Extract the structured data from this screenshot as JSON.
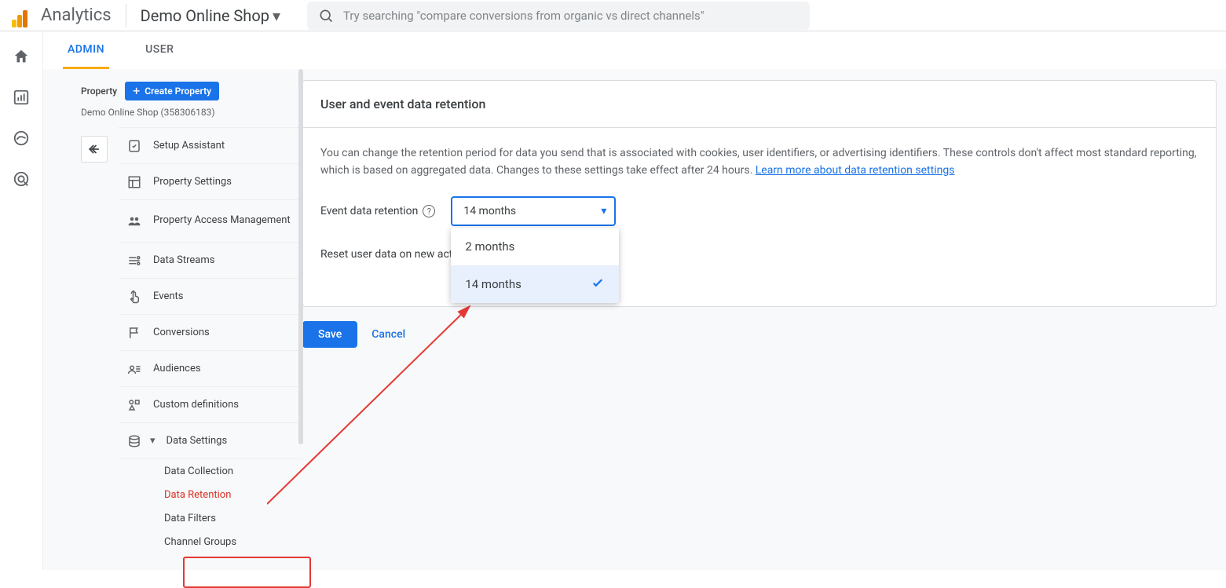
{
  "topbar": {
    "product": "Analytics",
    "account": "Demo Online Shop",
    "search_placeholder": "Try searching \"compare conversions from organic vs direct channels\""
  },
  "tabs": {
    "admin": "ADMIN",
    "user": "USER"
  },
  "sidebar": {
    "property_label": "Property",
    "create_button": "Create Property",
    "property_name": "Demo Online Shop (358306183)",
    "items": [
      {
        "label": "Setup Assistant"
      },
      {
        "label": "Property Settings"
      },
      {
        "label": "Property Access Management"
      },
      {
        "label": "Data Streams"
      },
      {
        "label": "Events"
      },
      {
        "label": "Conversions"
      },
      {
        "label": "Audiences"
      },
      {
        "label": "Custom definitions"
      },
      {
        "label": "Data Settings"
      }
    ],
    "sub_items": [
      {
        "label": "Data Collection"
      },
      {
        "label": "Data Retention"
      },
      {
        "label": "Data Filters"
      },
      {
        "label": "Channel Groups"
      }
    ]
  },
  "card": {
    "title": "User and event data retention",
    "description": "You can change the retention period for data you send that is associated with cookies, user identifiers, or advertising identifiers. These controls don't affect most standard reporting, which is based on aggregated data. Changes to these settings take effect after 24 hours. ",
    "learn_more": "Learn more about data retention settings",
    "field1_label": "Event data retention",
    "field2_label": "Reset user data on new activity",
    "select_value": "14 months",
    "options": [
      "2 months",
      "14 months"
    ],
    "save": "Save",
    "cancel": "Cancel"
  }
}
